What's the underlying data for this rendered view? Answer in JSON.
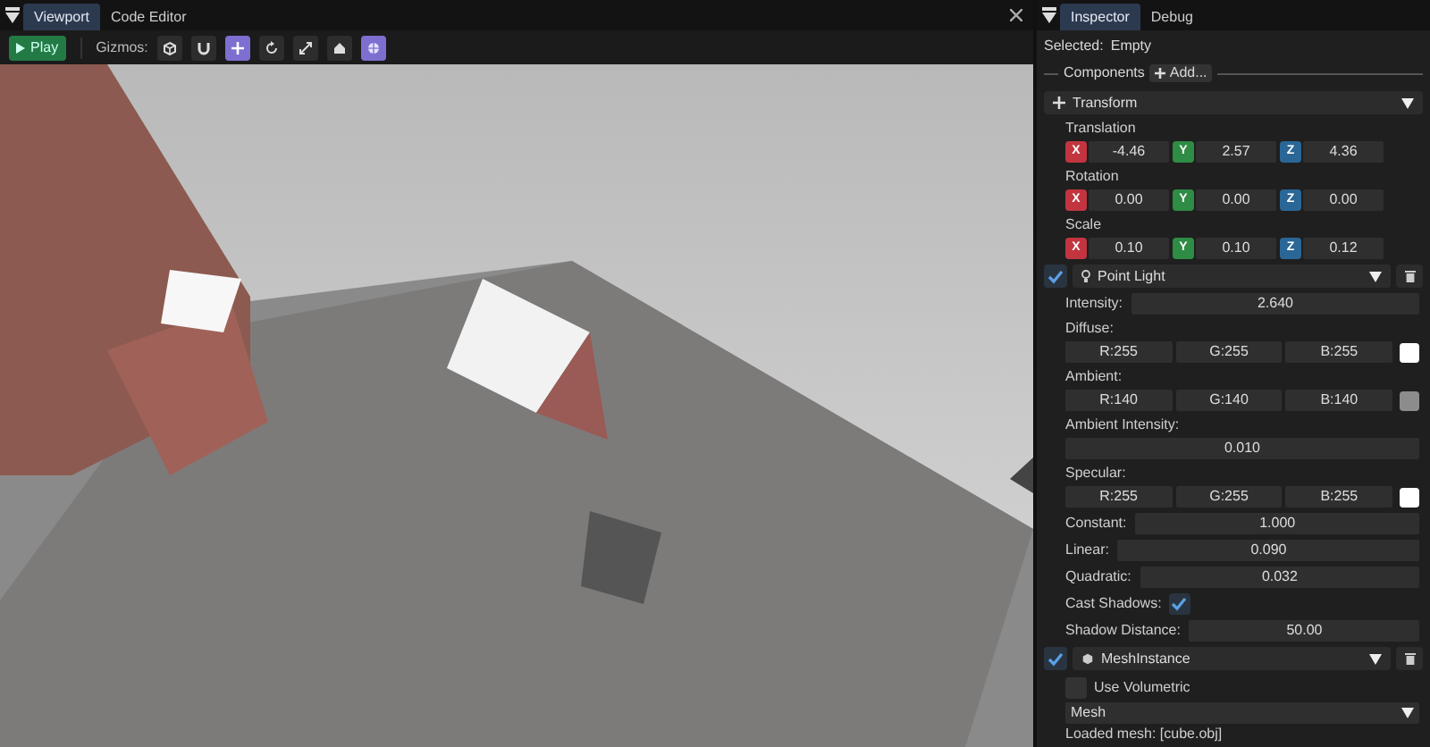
{
  "viewport_panel": {
    "tabs": [
      {
        "label": "Viewport",
        "selected": true
      },
      {
        "label": "Code Editor",
        "selected": false
      }
    ],
    "toolbar": {
      "play_button": "Play",
      "gizmos_label": "Gizmos:",
      "gizmo_tools": [
        {
          "selected": false
        },
        {
          "selected": false
        },
        {
          "selected": true
        },
        {
          "selected": false
        },
        {
          "selected": false
        },
        {
          "selected": false
        },
        {
          "selected": true
        }
      ]
    }
  },
  "inspector_panel": {
    "tabs": [
      {
        "label": "Inspector",
        "selected": true
      },
      {
        "label": "Debug",
        "selected": false
      }
    ],
    "selected_label": "Selected:",
    "selected_value": "Empty",
    "components_label": "Components",
    "add_button": "Add...",
    "components": [
      {
        "kind": "transform",
        "title": "Transform",
        "fields": [
          {
            "label": "Translation",
            "values": [
              {
                "axis": "X",
                "value": "-4.46"
              },
              {
                "axis": "Y",
                "value": "2.57"
              },
              {
                "axis": "Z",
                "value": "4.36"
              }
            ]
          },
          {
            "label": "Rotation",
            "values": [
              {
                "axis": "X",
                "value": "0.00"
              },
              {
                "axis": "Y",
                "value": "0.00"
              },
              {
                "axis": "Z",
                "value": "0.00"
              }
            ]
          },
          {
            "label": "Scale",
            "values": [
              {
                "axis": "X",
                "value": "0.10"
              },
              {
                "axis": "Y",
                "value": "0.10"
              },
              {
                "axis": "Z",
                "value": "0.12"
              }
            ]
          }
        ]
      },
      {
        "kind": "point_light",
        "title": "Point Light",
        "enabled": true,
        "properties": [
          {
            "kind": "inline_number",
            "label": "Intensity:",
            "value": "2.640"
          },
          {
            "kind": "color",
            "label": "Diffuse:",
            "channels": [
              "R:255",
              "G:255",
              "B:255"
            ],
            "color": "#ffffff"
          },
          {
            "kind": "color",
            "label": "Ambient:",
            "channels": [
              "R:140",
              "G:140",
              "B:140"
            ],
            "color": "#8c8c8c"
          },
          {
            "kind": "stacked_number",
            "label": "Ambient Intensity:",
            "value": "0.010"
          },
          {
            "kind": "color",
            "label": "Specular:",
            "channels": [
              "R:255",
              "G:255",
              "B:255"
            ],
            "color": "#ffffff"
          },
          {
            "kind": "inline_number",
            "label": "Constant:",
            "value": "1.000"
          },
          {
            "kind": "inline_number",
            "label": "Linear:",
            "value": "0.090"
          },
          {
            "kind": "inline_number",
            "label": "Quadratic:",
            "value": "0.032"
          },
          {
            "kind": "checkbox",
            "label": "Cast Shadows:",
            "checked": true
          },
          {
            "kind": "inline_number",
            "label": "Shadow Distance:",
            "value": "50.00"
          }
        ]
      },
      {
        "kind": "mesh_instance",
        "title": "MeshInstance",
        "enabled": true,
        "properties": [
          {
            "kind": "checkbox_left",
            "label": "Use Volumetric",
            "checked": false
          },
          {
            "kind": "dropdown",
            "value": "Mesh"
          },
          {
            "kind": "text",
            "text": "Loaded mesh: [cube.obj]"
          }
        ]
      }
    ]
  }
}
